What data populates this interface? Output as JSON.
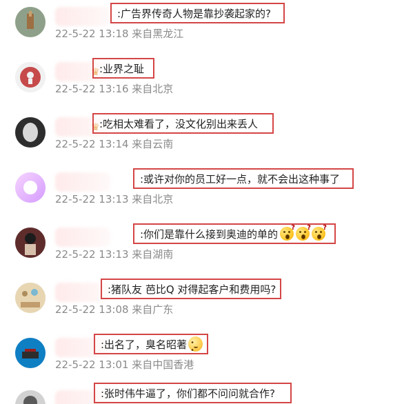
{
  "comments": [
    {
      "text": ":广告界传奇人物是靠抄袭起家的?",
      "meta": "22-5-22 13:18 来自黑龙江",
      "avatar": "avatar-icon",
      "crown": false,
      "emojis": []
    },
    {
      "text": ":业界之耻",
      "meta": "22-5-22 13:16 来自北京",
      "avatar": "avatar-icon",
      "crown": true,
      "emojis": []
    },
    {
      "text": ":吃相太难看了，没文化别出来丢人",
      "meta": "22-5-22 13:14 来自云南",
      "avatar": "avatar-icon",
      "crown": true,
      "emojis": []
    },
    {
      "text": ":或许对你的员工好一点，就不会出这种事了",
      "meta": "22-5-22 13:13 来自北京",
      "avatar": "avatar-icon",
      "crown": false,
      "emojis": []
    },
    {
      "text": ":你们是靠什么接到奥迪的单的",
      "meta": "22-5-22 13:13 来自湖南",
      "avatar": "avatar-icon",
      "crown": false,
      "emojis": [
        "question-face-icon",
        "question-face-icon",
        "question-face-icon"
      ]
    },
    {
      "text": ":猪队友 芭比Q 对得起客户和费用吗?",
      "meta": "22-5-22 13:08 来自广东",
      "avatar": "avatar-icon",
      "crown": false,
      "emojis": []
    },
    {
      "text": ":出名了，臭名昭著",
      "meta": "22-5-22 13:01 来自中国香港",
      "avatar": "avatar-icon",
      "crown": false,
      "emojis": [
        "cat-face-icon"
      ]
    },
    {
      "text": ":张时伟牛逼了，你们都不问问就合作?",
      "meta": "",
      "avatar": "avatar-icon",
      "crown": false,
      "emojis": []
    }
  ],
  "colors": {
    "highlight_border": "#d44545",
    "meta_text": "#8a8a8a"
  }
}
